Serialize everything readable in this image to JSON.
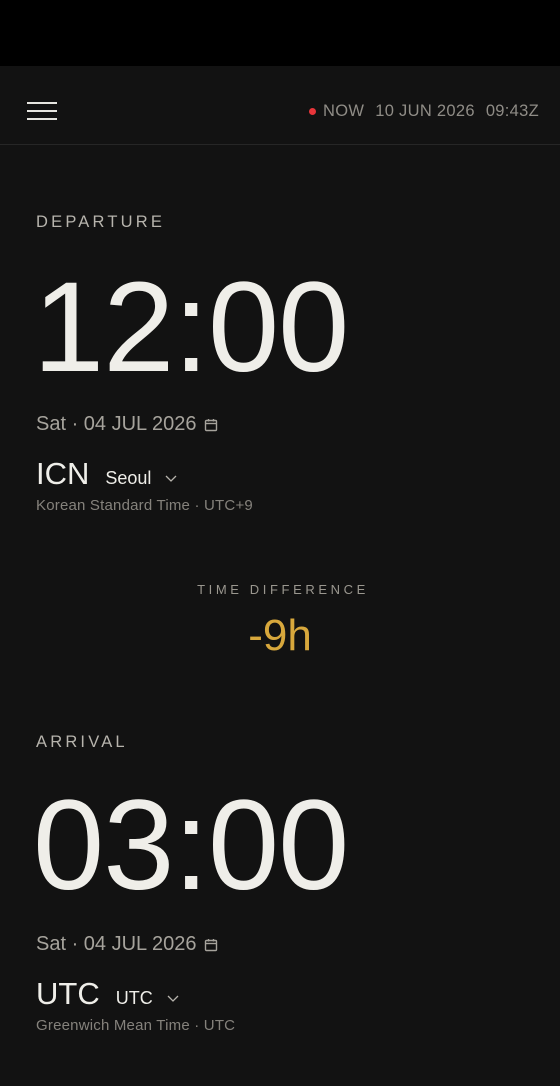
{
  "header": {
    "now_label": "NOW",
    "now_date": "10 JUN 2026",
    "now_time": "09:43Z"
  },
  "departure": {
    "label": "DEPARTURE",
    "time": "12:00",
    "date": "Sat · 04 JUL 2026",
    "code": "ICN",
    "city": "Seoul",
    "timezone": "Korean Standard Time · UTC+9"
  },
  "difference": {
    "label": "TIME DIFFERENCE",
    "value": "-9h"
  },
  "arrival": {
    "label": "ARRIVAL",
    "time": "03:00",
    "date": "Sat · 04 JUL 2026",
    "code": "UTC",
    "city": "UTC",
    "timezone": "Greenwich Mean Time · UTC"
  },
  "colors": {
    "background": "#121212",
    "accent": "#d8a83c",
    "live_dot": "#e8353a"
  },
  "icons": [
    "menu-icon",
    "calendar-icon",
    "chevron-down-icon"
  ]
}
